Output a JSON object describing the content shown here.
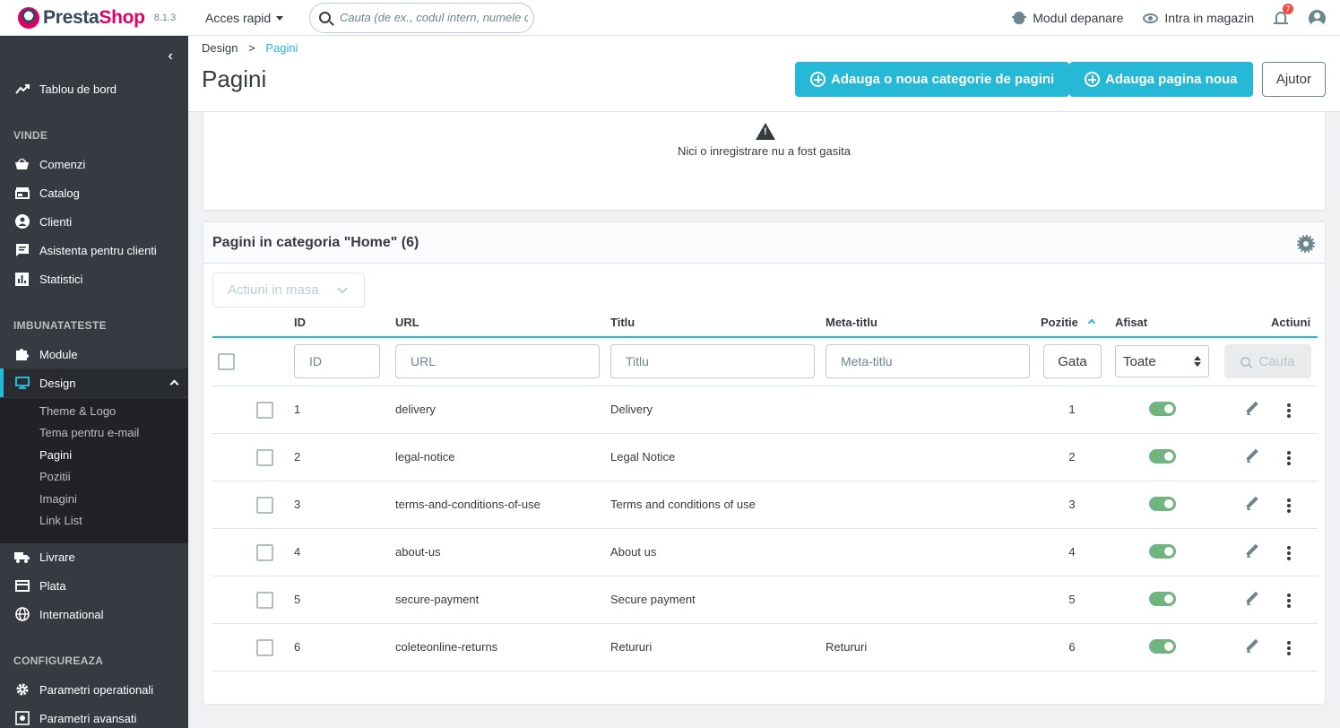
{
  "header": {
    "brand_a": "Presta",
    "brand_b": "Shop",
    "version": "8.1.3",
    "quick_access": "Acces rapid",
    "search_placeholder": "Cauta (de ex., codul intern, numele client)",
    "debug_mode": "Modul depanare",
    "view_shop": "Intra in magazin",
    "notifications_count": "7",
    "icons": [
      "search-icon",
      "bug-icon",
      "eye-icon",
      "bell-icon",
      "user-icon"
    ]
  },
  "sidebar": {
    "dashboard": "Tablou de bord",
    "sections": [
      "VINDE",
      "IMBUNATATESTE",
      "CONFIGUREAZA"
    ],
    "sell_items": [
      "Comenzi",
      "Catalog",
      "Clienti",
      "Asistenta pentru clienti",
      "Statistici"
    ],
    "improve_items": [
      "Module",
      "Design"
    ],
    "design_sub": [
      "Theme & Logo",
      "Tema pentru e-mail",
      "Pagini",
      "Pozitii",
      "Imagini",
      "Link List"
    ],
    "more_items": [
      "Livrare",
      "Plata",
      "International"
    ],
    "configure_items": [
      "Parametri operationali",
      "Parametri avansati"
    ],
    "accent_color": "#25b9d7"
  },
  "page": {
    "breadcrumb_parent": "Design",
    "breadcrumb_sep": ">",
    "breadcrumb_current": "Pagini",
    "title": "Pagini",
    "btn_add_category": "Adauga o noua categorie de pagini",
    "btn_add_page": "Adauga pagina noua",
    "btn_help": "Ajutor"
  },
  "empty_card": {
    "message": "Nici o inregistrare nu a fost gasita"
  },
  "pages_card": {
    "title": "Pagini in categoria \"Home\" (6)",
    "bulk_actions": "Actiuni in masa",
    "columns": {
      "id": "ID",
      "url": "URL",
      "title": "Titlu",
      "meta_title": "Meta-titlu",
      "position": "Pozitie",
      "display": "Afisat",
      "actions": "Actiuni"
    },
    "filters": {
      "id": "ID",
      "url": "URL",
      "title": "Titlu",
      "meta_title": "Meta-titlu",
      "position_btn": "Gata",
      "display_select": "Toate",
      "search_btn": "Cauta"
    },
    "rows": [
      {
        "id": "1",
        "url": "delivery",
        "title": "Delivery",
        "meta": "",
        "position": "1",
        "active": true
      },
      {
        "id": "2",
        "url": "legal-notice",
        "title": "Legal Notice",
        "meta": "",
        "position": "2",
        "active": true
      },
      {
        "id": "3",
        "url": "terms-and-conditions-of-use",
        "title": "Terms and conditions of use",
        "meta": "",
        "position": "3",
        "active": true
      },
      {
        "id": "4",
        "url": "about-us",
        "title": "About us",
        "meta": "",
        "position": "4",
        "active": true
      },
      {
        "id": "5",
        "url": "secure-payment",
        "title": "Secure payment",
        "meta": "",
        "position": "5",
        "active": true
      },
      {
        "id": "6",
        "url": "coleteonline-returns",
        "title": "Retururi",
        "meta": "Retururi",
        "position": "6",
        "active": true
      }
    ],
    "toggle_color": "#70b580"
  }
}
